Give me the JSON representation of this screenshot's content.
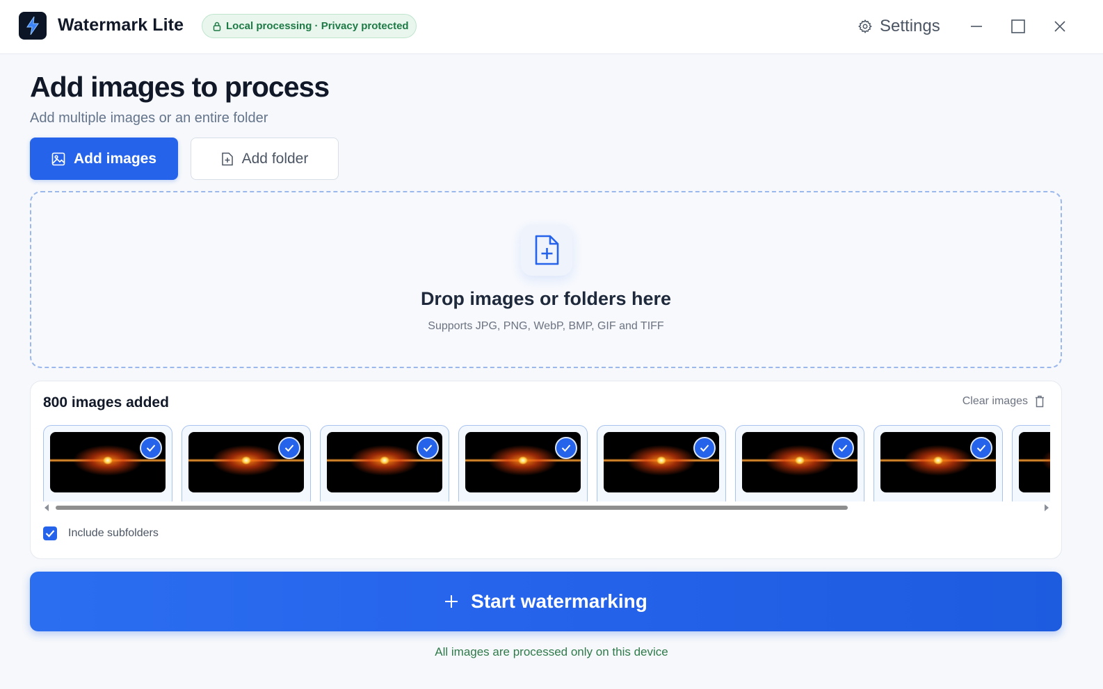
{
  "app": {
    "title": "Watermark Lite",
    "privacy_badge": "Local processing · Privacy protected",
    "settings_label": "Settings"
  },
  "header": {
    "title": "Add images to process",
    "subtitle": "Add multiple images or an entire folder",
    "add_images_label": "Add images",
    "add_folder_label": "Add folder"
  },
  "dropzone": {
    "title": "Drop images or folders here",
    "hint": "Supports JPG, PNG, WebP, BMP, GIF and TIFF",
    "icon": "file-plus-icon"
  },
  "images": {
    "count_label": "800 images added",
    "clear_label": "Clear images",
    "thumbnails": [
      {
        "selected": true
      },
      {
        "selected": true
      },
      {
        "selected": true
      },
      {
        "selected": true
      },
      {
        "selected": true
      },
      {
        "selected": true
      },
      {
        "selected": true
      },
      {
        "selected": true
      }
    ],
    "include_subfolders_label": "Include subfolders",
    "include_subfolders": true
  },
  "actions": {
    "start_label": "Start watermarking"
  },
  "footer": {
    "note": "All images are processed only on this device"
  },
  "colors": {
    "accent": "#2563eb",
    "success_text": "#1e7a45",
    "badge_bg": "#e8f6ee"
  }
}
